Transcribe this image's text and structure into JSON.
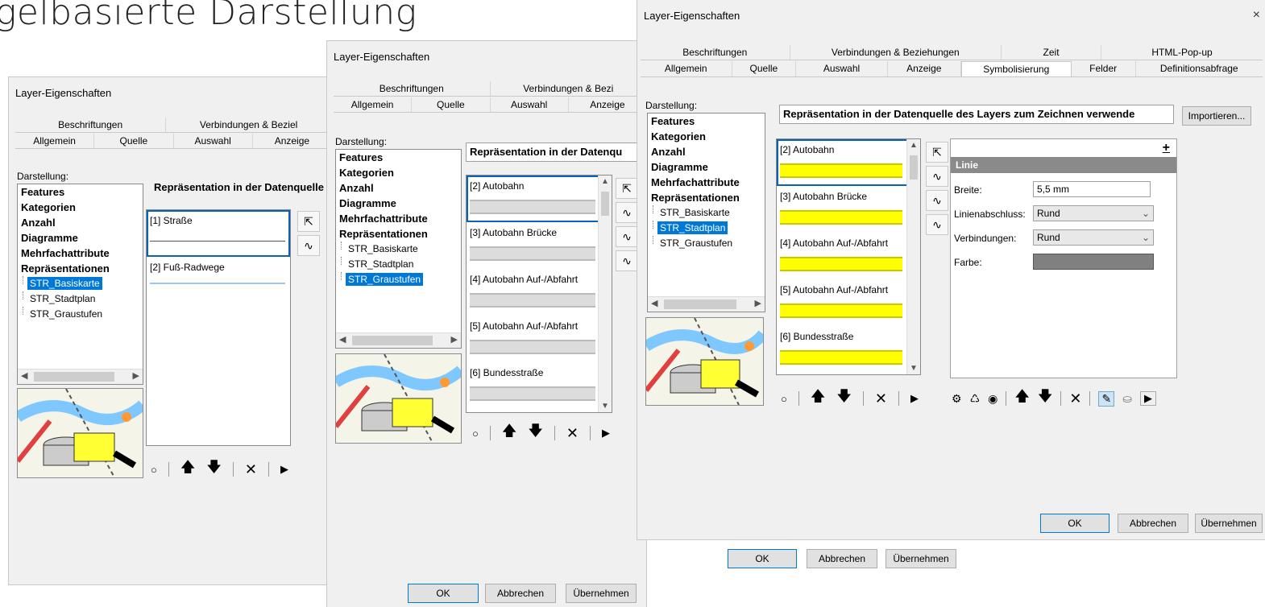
{
  "heading": "gelbasierte Darstellung",
  "dialog1": {
    "title": "Layer-Eigenschaften",
    "tabs_top": [
      "Beschriftungen",
      "Verbindungen & Beziel"
    ],
    "tabs_bottom": [
      "Allgemein",
      "Quelle",
      "Auswahl",
      "Anzeige"
    ],
    "darstellung_label": "Darstellung:",
    "tree": {
      "nodes": [
        "Features",
        "Kategorien",
        "Anzahl",
        "Diagramme",
        "Mehrfachattribute",
        "Repräsentationen"
      ],
      "children": [
        "STR_Basiskarte",
        "STR_Stadtplan",
        "STR_Graustufen"
      ],
      "selected": "STR_Basiskarte"
    },
    "rep_text": "Repräsentation in der Datenquelle",
    "items": [
      "[1] Straße",
      "[2] Fuß-Radwege"
    ]
  },
  "dialog2": {
    "title": "Layer-Eigenschaften",
    "tabs_top": [
      "Beschriftungen",
      "Verbindungen & Bezi"
    ],
    "tabs_bottom": [
      "Allgemein",
      "Quelle",
      "Auswahl",
      "Anzeige"
    ],
    "darstellung_label": "Darstellung:",
    "tree": {
      "nodes": [
        "Features",
        "Kategorien",
        "Anzahl",
        "Diagramme",
        "Mehrfachattribute",
        "Repräsentationen"
      ],
      "children": [
        "STR_Basiskarte",
        "STR_Stadtplan",
        "STR_Graustufen"
      ],
      "selected": "STR_Graustufen"
    },
    "rep_text": "Repräsentation in der Datenqu",
    "items": [
      "[2] Autobahn",
      "[3] Autobahn Brücke",
      "[4] Autobahn Auf-/Abfahrt",
      "[5] Autobahn Auf-/Abfahrt",
      "[6] Bundesstraße"
    ],
    "buttons": {
      "ok": "OK",
      "cancel": "Abbrechen",
      "apply": "Übernehmen"
    }
  },
  "dialog3": {
    "title": "Layer-Eigenschaften",
    "close": "×",
    "tabs_top": [
      "Beschriftungen",
      "Verbindungen & Beziehungen",
      "Zeit",
      "HTML-Pop-up"
    ],
    "tabs_bottom": [
      "Allgemein",
      "Quelle",
      "Auswahl",
      "Anzeige",
      "Symbolisierung",
      "Felder",
      "Definitionsabfrage"
    ],
    "active_tab": "Symbolisierung",
    "darstellung_label": "Darstellung:",
    "tree": {
      "nodes": [
        "Features",
        "Kategorien",
        "Anzahl",
        "Diagramme",
        "Mehrfachattribute",
        "Repräsentationen"
      ],
      "children": [
        "STR_Basiskarte",
        "STR_Stadtplan",
        "STR_Graustufen"
      ],
      "selected": "STR_Stadtplan"
    },
    "rep_text": "Repräsentation in der Datenquelle des Layers zum Zeichnen verwende",
    "import_button": "Importieren...",
    "items": [
      "[2] Autobahn",
      "[3] Autobahn Brücke",
      "[4] Autobahn Auf-/Abfahrt",
      "[5] Autobahn Auf-/Abfahrt",
      "[6] Bundesstraße"
    ],
    "props": {
      "header": "Linie",
      "plus": "+",
      "breite_label": "Breite:",
      "breite_value": "5,5 mm",
      "abschluss_label": "Linienabschluss:",
      "abschluss_value": "Rund",
      "verbindungen_label": "Verbindungen:",
      "verbindungen_value": "Rund",
      "farbe_label": "Farbe:",
      "farbe_color": "#808080"
    },
    "buttons": {
      "ok": "OK",
      "cancel": "Abbrechen",
      "apply": "Übernehmen"
    }
  },
  "dialog2_bottom_buttons": {
    "ok": "OK",
    "cancel": "Abbrechen",
    "apply": "Übernehmen"
  },
  "colors": {
    "selection": "#0078d7",
    "symbol_yellow": "#ffff00",
    "symbol_gray": "#dcdcdc"
  }
}
